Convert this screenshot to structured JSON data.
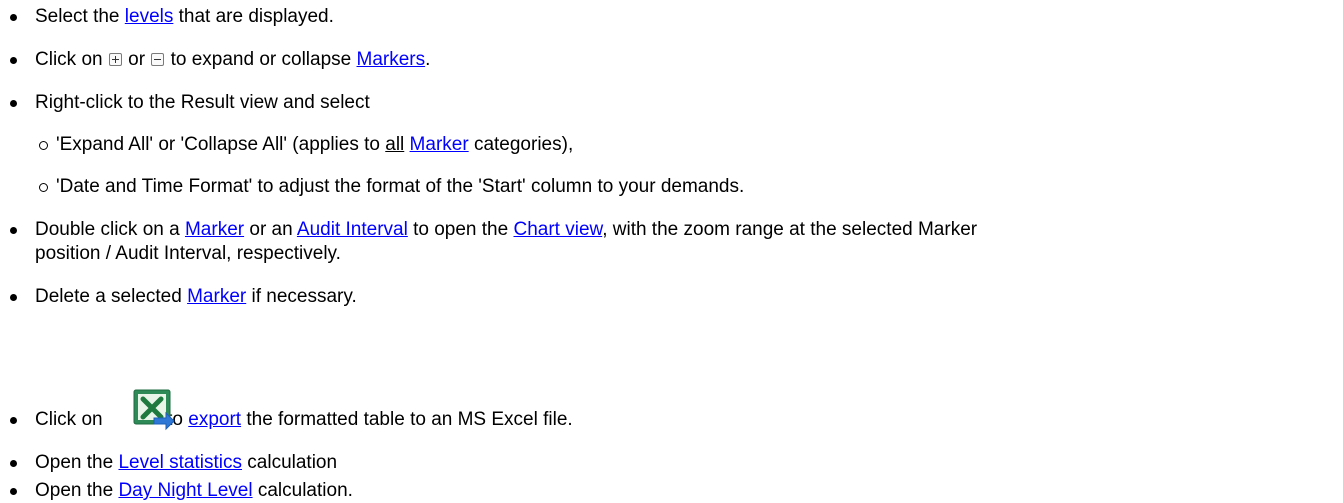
{
  "items": [
    {
      "pre": "Select the ",
      "link": "levels",
      "post": " that are displayed."
    },
    {
      "pre": "Click on ",
      "mid": " or ",
      "mid2": " to expand or collapse ",
      "link": "Markers",
      "post": "."
    },
    {
      "text": "Right-click to the Result view and select"
    },
    {
      "pre": "'Expand All' or 'Collapse All' (applies to ",
      "under": "all",
      "sp": " ",
      "link": "Marker",
      "post": " categories),"
    },
    {
      "text": "'Date and Time Format' to adjust the format of the 'Start' column to your demands."
    },
    {
      "pre": "Double click on a ",
      "link1": "Marker",
      "mid": " or an ",
      "link2": "Audit Interval",
      "mid2": " to open the ",
      "link3": "Chart view",
      "post": ", with the zoom range at the selected Marker",
      "line2": "position / Audit Interval, respectively."
    },
    {
      "pre": "Delete a selected ",
      "link": "Marker",
      "post": " if necessary."
    },
    {
      "pre": "Click on ",
      "mid": " to ",
      "link": "export",
      "post": " the formatted table to an MS Excel file."
    },
    {
      "pre": "Open the ",
      "link": "Level statistics",
      "post": " calculation"
    },
    {
      "pre": "Open the ",
      "link": "Day Night Level",
      "post": " calculation."
    }
  ],
  "icons": {
    "expand": "expand-plus-icon",
    "collapse": "collapse-minus-icon",
    "excel": "excel-export-icon"
  }
}
